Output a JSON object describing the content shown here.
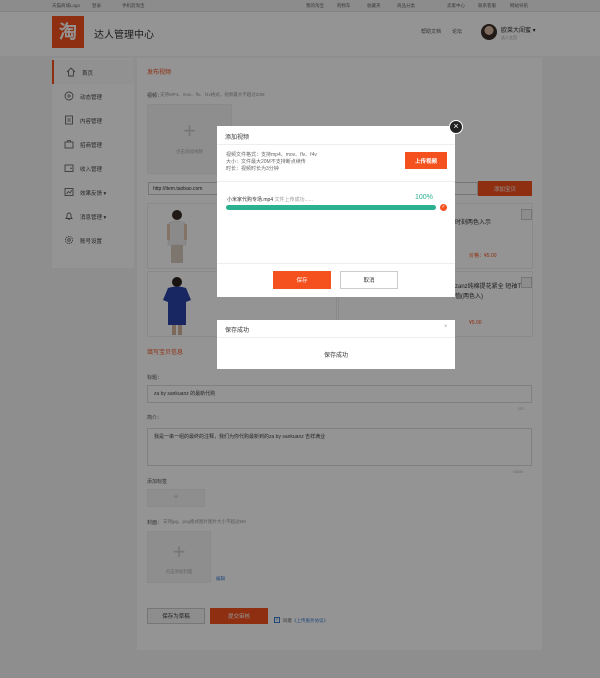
{
  "topbar": {
    "left_items": [
      "天猫商城Logo",
      "登录",
      "手机逛淘宝"
    ],
    "right_items": [
      "我的淘宝",
      "购物车",
      "收藏夹",
      "商品分类",
      "卖家中心",
      "联系客服",
      "网站导航"
    ]
  },
  "header": {
    "logo_text": "淘",
    "title": "达人管理中心",
    "links": [
      "帮助文档",
      "论坛"
    ],
    "user_name": "欧莱大闺蜜",
    "user_sub": "达人主页"
  },
  "sidebar": {
    "items": [
      {
        "label": "首页",
        "icon": "home-icon"
      },
      {
        "label": "动态管理",
        "icon": "feed-icon"
      },
      {
        "label": "内容管理",
        "icon": "document-icon"
      },
      {
        "label": "招商管理",
        "icon": "briefcase-icon"
      },
      {
        "label": "收入管理",
        "icon": "wallet-icon"
      },
      {
        "label": "效果反馈",
        "icon": "chart-icon"
      },
      {
        "label": "消息管理",
        "icon": "bell-icon"
      },
      {
        "label": "账号设置",
        "icon": "gear-icon"
      }
    ]
  },
  "main": {
    "section_title": "发布视频",
    "video_label": "视频：",
    "video_hint": "支持MP4、mov、flv、f4v格式，视频最大不超过20M",
    "upload_caption": "点击添加视频",
    "url_value": "http://item.taobao.com",
    "add_button": "添加宝贝",
    "products": [
      {
        "title": "时刻两色入示",
        "price": "价格：¥5.00"
      },
      {
        "title": "zanz纯棉提花紧全 短袖T恤(两色入)",
        "price": "¥5.00"
      }
    ],
    "edit_section": "填写宝贝信息",
    "title_label": "标题：",
    "title_value": "za by sankuanz 的最新代购",
    "title_counter": "/22",
    "intro_label": "简介：",
    "intro_value": "我是一串一组的最终的注释，我们为你代购最新到的za by sankuanz 吉祥满业",
    "intro_counter": "/1000",
    "tag_label": "添加标签",
    "tag_plus": "+",
    "cover_label": "封面：",
    "cover_hint": "支持jpg、png格式图片图片大小不超过5M",
    "cover_caption": "点击添加封面",
    "cover_edit": "编辑",
    "save_draft": "保存为草稿",
    "submit": "提交审核",
    "agree_prefix": "同意",
    "agree_link": "《上传服务协议》"
  },
  "modal": {
    "title": "添加视频",
    "requirements": [
      "视频文件格式：支持mp4、mov、flv、f4v",
      "大小：文件最大20M不支持断点续传",
      "时长：视频时长为3分钟"
    ],
    "upload_button": "上传视频",
    "file_name": "小米家代购专场.mp4",
    "file_status": "文件上传成功......",
    "progress": 100,
    "percent_text": "100%",
    "save": "保存",
    "cancel": "取消",
    "close": "×"
  },
  "toast": {
    "title": "保存成功",
    "message": "保存成功",
    "close": "×"
  },
  "colors": {
    "accent": "#f4511e",
    "progress": "#2bb191",
    "overlay": "rgba(0,0,0,0.42)"
  }
}
